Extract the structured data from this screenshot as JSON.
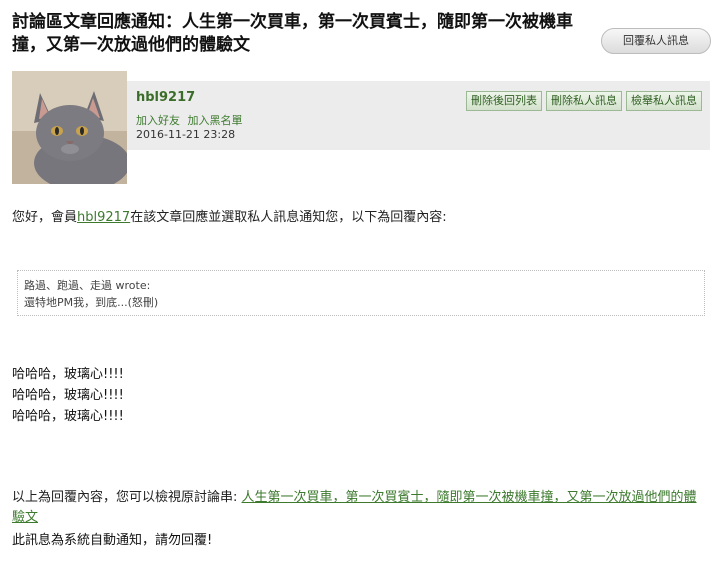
{
  "title": "討論區文章回應通知：人生第一次買車，第一次買賓士，隨即第一次被機車撞，又第一次放過他們的體驗文",
  "reply_button": "回覆私人訊息",
  "user": {
    "name": "hbl9217",
    "add_friend": "加入好友",
    "add_blacklist": "加入黑名單",
    "date": "2016-11-21 23:28"
  },
  "actions": {
    "delete_back": "刪除後回列表",
    "delete_msg": "刪除私人訊息",
    "report_msg": "檢舉私人訊息"
  },
  "intro": {
    "before": "您好，會員",
    "user_link": "hbl9217",
    "after": "在該文章回應並選取私人訊息通知您，以下為回覆內容:"
  },
  "quote": {
    "header": "路過、跑過、走過 wrote:",
    "text": "還特地PM我，到底...(怒刪)"
  },
  "message_lines": [
    "哈哈哈，玻璃心!!!!",
    "哈哈哈，玻璃心!!!!",
    "哈哈哈，玻璃心!!!!"
  ],
  "outro": {
    "before": "以上為回覆內容，您可以檢視原討論串: ",
    "link": "人生第一次買車，第一次買賓士，隨即第一次被機車撞，又第一次放過他們的體驗文"
  },
  "notice": "此訊息為系統自動通知，請勿回覆!",
  "colors": {
    "link_green": "#3d7a2e",
    "bar_gray": "#ececec"
  }
}
